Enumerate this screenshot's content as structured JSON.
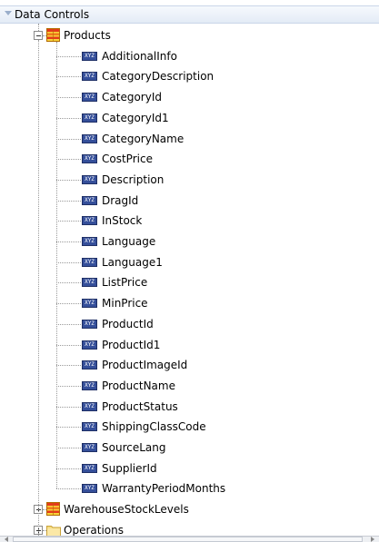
{
  "panel": {
    "title": "Data Controls",
    "accent": "#e3ebf6"
  },
  "tree": {
    "root": {
      "label": "Products",
      "icon": "table-icon",
      "expanded": true,
      "attributes": [
        "AdditionalInfo",
        "CategoryDescription",
        "CategoryId",
        "CategoryId1",
        "CategoryName",
        "CostPrice",
        "Description",
        "DragId",
        "InStock",
        "Language",
        "Language1",
        "ListPrice",
        "MinPrice",
        "ProductId",
        "ProductId1",
        "ProductImageId",
        "ProductName",
        "ProductStatus",
        "ShippingClassCode",
        "SourceLang",
        "SupplierId",
        "WarrantyPeriodMonths"
      ],
      "attribute_icon_text": "XYZ"
    },
    "children": [
      {
        "label": "WarehouseStockLevels",
        "icon": "table-icon",
        "expanded": false
      },
      {
        "label": "Operations",
        "icon": "folder-icon",
        "expanded": false
      }
    ]
  }
}
